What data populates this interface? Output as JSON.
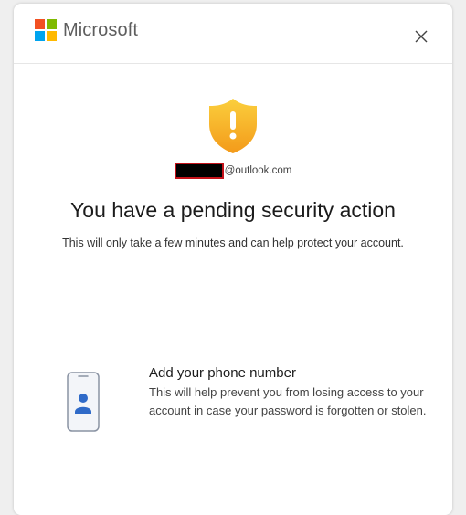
{
  "brand": {
    "name": "Microsoft",
    "logo_colors": [
      "#f25022",
      "#7fba00",
      "#00a4ef",
      "#ffb900"
    ]
  },
  "header": {
    "close_icon": "close-icon"
  },
  "alert": {
    "icon": "warning-shield-icon",
    "shield_color": "#f5b324"
  },
  "account": {
    "domain_suffix": "@outlook.com"
  },
  "main": {
    "title": "You have a pending security action",
    "subtitle": "This will only take a few minutes and can help protect your account."
  },
  "action": {
    "icon": "phone-person-icon",
    "title": "Add your phone number",
    "description": "This will help prevent you from losing access to your account in case your password is forgotten or stolen."
  }
}
